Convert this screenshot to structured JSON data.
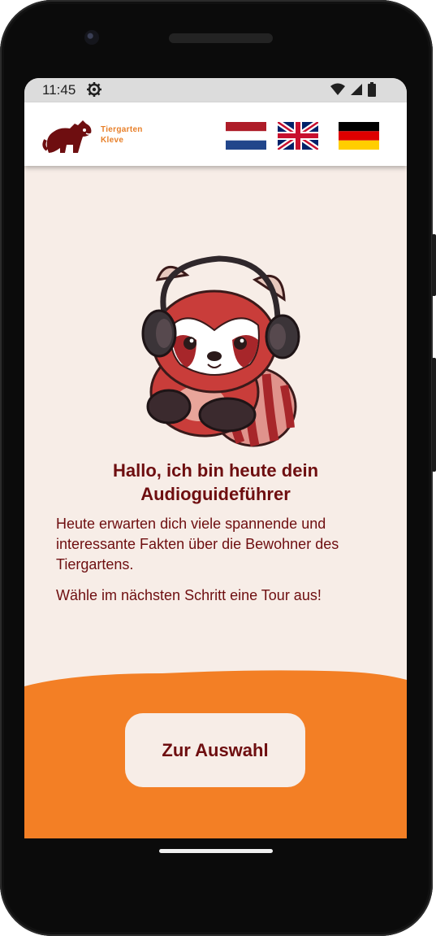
{
  "status_bar": {
    "time": "11:45"
  },
  "header": {
    "logo_line1": "Tiergarten",
    "logo_line2": "Kleve",
    "languages": [
      {
        "code": "nl",
        "icon": "netherlands-flag-icon"
      },
      {
        "code": "en",
        "icon": "uk-flag-icon"
      },
      {
        "code": "de",
        "icon": "germany-flag-icon"
      }
    ]
  },
  "main": {
    "mascot_icon": "red-panda-headphones-illustration",
    "heading": "Hallo, ich bin heute dein Audioguideführer",
    "paragraph1": "Heute erwarten dich viele spannende und interessante Fakten über die Bewohner des Tiergartens.",
    "paragraph2": "Wähle im nächsten Schritt eine Tour aus!",
    "cta_label": "Zur Auswahl"
  },
  "colors": {
    "primary_dark": "#6e0e10",
    "accent_orange": "#f37f25",
    "background": "#f7ede7"
  }
}
